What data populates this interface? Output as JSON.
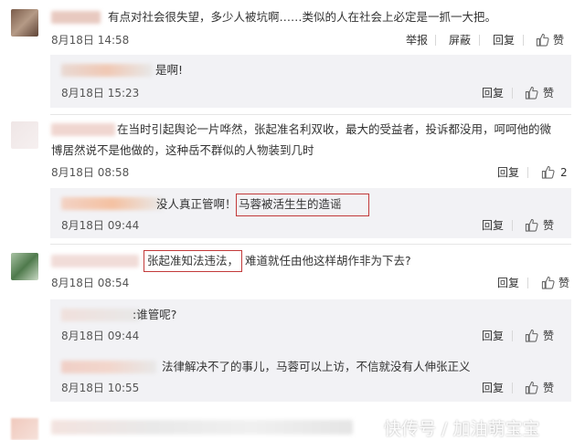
{
  "comments": [
    {
      "text": "有点对社会很失望，多少人被坑啊……类似的人在社会上必定是一抓一大把。",
      "time": "8月18日 14:58",
      "actions": [
        "举报",
        "屏蔽",
        "回复",
        "赞"
      ],
      "replies": [
        {
          "text": "是啊!",
          "time": "8月18日 15:23",
          "actions": [
            "回复",
            "赞"
          ]
        }
      ]
    },
    {
      "text_line1": "在当时引起舆论一片哗然，张起准名利双收，最大的受益者，投诉都没用，呵呵他的微",
      "text_line2": "博居然说不是他做的，这种岳不群似的人物装到几时",
      "time": "8月18日 08:58",
      "actions": [
        "回复",
        "2"
      ],
      "replies": [
        {
          "text_prefix": "没人真正管啊！",
          "text_highlight": "马蓉被活生生的造谣",
          "time": "8月18日 09:44",
          "actions": [
            "回复",
            "赞"
          ]
        }
      ]
    },
    {
      "text_highlight": "张起准知法违法，",
      "text_rest": "难道就任由他这样胡作非为下去?",
      "time": "8月18日 08:54",
      "actions": [
        "回复",
        "赞"
      ],
      "replies": [
        {
          "text": ":谁管呢?",
          "time": "8月18日 09:44",
          "actions": [
            "回复",
            "赞"
          ]
        },
        {
          "text": "法律解决不了的事儿，马蓉可以上访，不信就没有人伸张正义",
          "time": "8月18日 10:55",
          "actions": [
            "回复",
            "赞"
          ]
        }
      ]
    }
  ],
  "watermark": "快传号 / 加油萌宝宝",
  "colors": {
    "highlight_border": "#c23a3a",
    "reply_bg": "#f2f2f5"
  },
  "icons": [
    "thumb-up-icon"
  ]
}
